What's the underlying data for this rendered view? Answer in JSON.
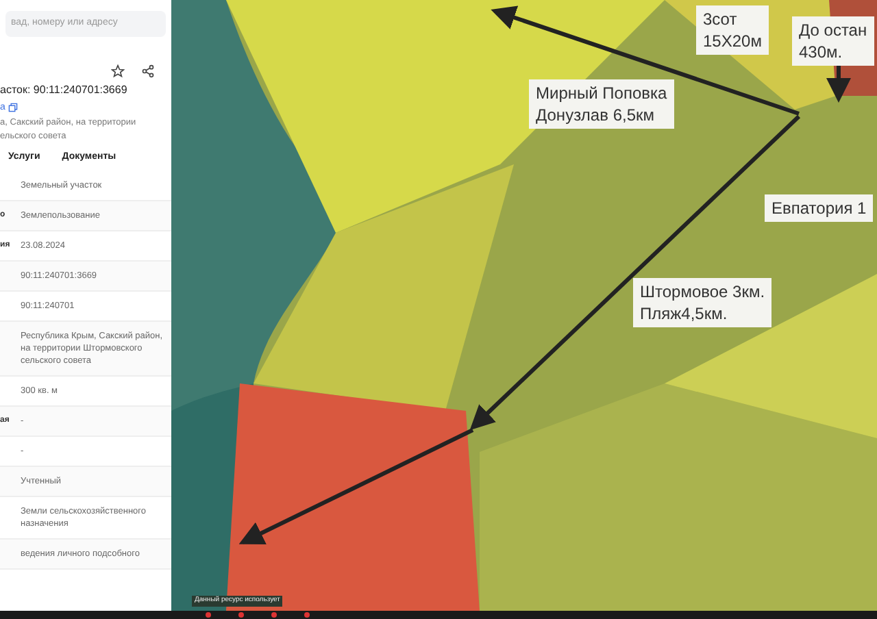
{
  "search": {
    "placeholder": "вад, номеру или адресу"
  },
  "card": {
    "title": "асток: 90:11:240701:3669",
    "link": "а",
    "address_line_1": "а, Сакский район, на территории",
    "address_line_2": "ельского совета",
    "tabs": [
      "Услуги",
      "Документы"
    ],
    "rows": [
      {
        "label": "",
        "value": "Земельный участок"
      },
      {
        "label": "о",
        "value": "Землепользование"
      },
      {
        "label": "ия",
        "value": "23.08.2024"
      },
      {
        "label": "",
        "value": "90:11:240701:3669"
      },
      {
        "label": "",
        "value": "90:11:240701"
      },
      {
        "label": "",
        "value": "Республика Крым, Сакский район, на территории Штормовского сельского совета"
      },
      {
        "label": "",
        "value": "300 кв. м"
      },
      {
        "label": "ая",
        "value": "-"
      },
      {
        "label": "",
        "value": "-"
      },
      {
        "label": "",
        "value": "Учтенный"
      },
      {
        "label": "",
        "value": "Земли сельскохозяйственного назначения"
      },
      {
        "label": "",
        "value": "ведения личного подсобного"
      }
    ]
  },
  "map": {
    "labels": [
      {
        "lines": [
          "3сот",
          "15Х20м"
        ]
      },
      {
        "lines": [
          "До остан",
          "430м."
        ]
      },
      {
        "lines": [
          "Мирный Поповка",
          "Донузлав 6,5км"
        ]
      },
      {
        "lines": [
          "Евпатория 1"
        ]
      },
      {
        "lines": [
          "Штормовое 3км.",
          "Пляж4,5км."
        ]
      }
    ],
    "disclaimer": "Данный ресурс использует"
  }
}
